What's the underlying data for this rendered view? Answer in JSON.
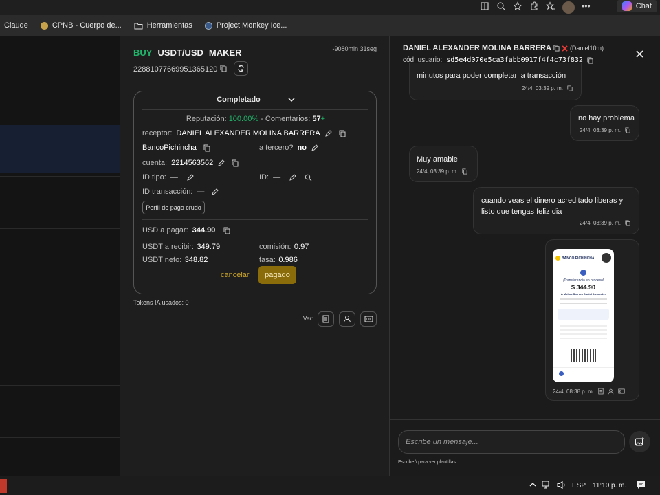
{
  "browser": {
    "chat_label": "Chat",
    "bookmarks": [
      {
        "label": "Claude",
        "icon": "claude-icon"
      },
      {
        "label": "CPNB - Cuerpo de...",
        "icon": "site-icon"
      },
      {
        "label": "Herramientas",
        "icon": "folder-icon"
      },
      {
        "label": "Project Monkey Ice...",
        "icon": "site-icon"
      }
    ]
  },
  "order": {
    "side": "BUY",
    "pair": "USDT/USD",
    "role": "MAKER",
    "timer": "-9080min 31seg",
    "id": "22881077669951365120",
    "status": "Completado",
    "reputation_label": "Reputación:",
    "reputation_value": "100.00%",
    "comments_label": " - Comentarios:",
    "comments_value": "57",
    "comments_plus": "+",
    "receptor_label": "receptor:",
    "receptor_value": "DANIEL ALEXANDER MOLINA BARRERA",
    "bank": "BancoPichincha",
    "third_label": "a tercero?",
    "third_value": "no",
    "account_label": "cuenta:",
    "account_value": "2214563562",
    "idtype_label": "ID tipo:",
    "idtype_value": "—",
    "id_label": "ID:",
    "id_value": "—",
    "txid_label": "ID transacción:",
    "txid_value": "—",
    "raw_profile_btn": "Perfil de pago crudo",
    "usd_pay_label": "USD a pagar:",
    "usd_pay_value": "344.90",
    "usdt_receive_label": "USDT a recibir:",
    "usdt_receive_value": "349.79",
    "commission_label": "comisión:",
    "commission_value": "0.97",
    "usdt_net_label": "USDT neto:",
    "usdt_net_value": "348.82",
    "rate_label": "tasa:",
    "rate_value": "0.986",
    "cancel_label": "cancelar",
    "paid_label": "pagado",
    "tokens_label": "Tokens IA usados: 0",
    "view_label": "Ver:"
  },
  "chat": {
    "user_name": "DANIEL ALEXANDER MOLINA BARRERA",
    "user_alias": "(Daniel10m)",
    "user_code_label": "cód. usuario:",
    "user_code_value": "sd5e4d070e5ca3fabb0917f4f4c73f832",
    "messages": [
      {
        "text": "minutos para poder completar la transacción",
        "time": "24/4, 03:39 p. m."
      },
      {
        "text": "no hay problema",
        "time": "24/4, 03:39 p. m."
      },
      {
        "text": "Muy amable",
        "time": "24/4, 03:39 p. m."
      },
      {
        "text": "cuando veas el dinero acreditado liberas y listo que tengas feliz dia",
        "time": "24/4, 03:39 p. m."
      }
    ],
    "image_time": "24/4, 08:38 p. m.",
    "receipt": {
      "bank": "BANCO PICHINCHA",
      "title": "¡Transferencia en proceso!",
      "amount": "$ 344.90",
      "recipient": "A Molina Barrera Daniel Alexander"
    },
    "input_placeholder": "Escribe un mensaje...",
    "hint": "Escribe \\ para ver plantillas"
  },
  "taskbar": {
    "lang": "ESP",
    "time": "11:10 p. m."
  },
  "colors": {
    "green": "#21b36a",
    "gold": "#c9a32a",
    "paid_bg": "#8a6d0a",
    "red": "#e53935"
  }
}
